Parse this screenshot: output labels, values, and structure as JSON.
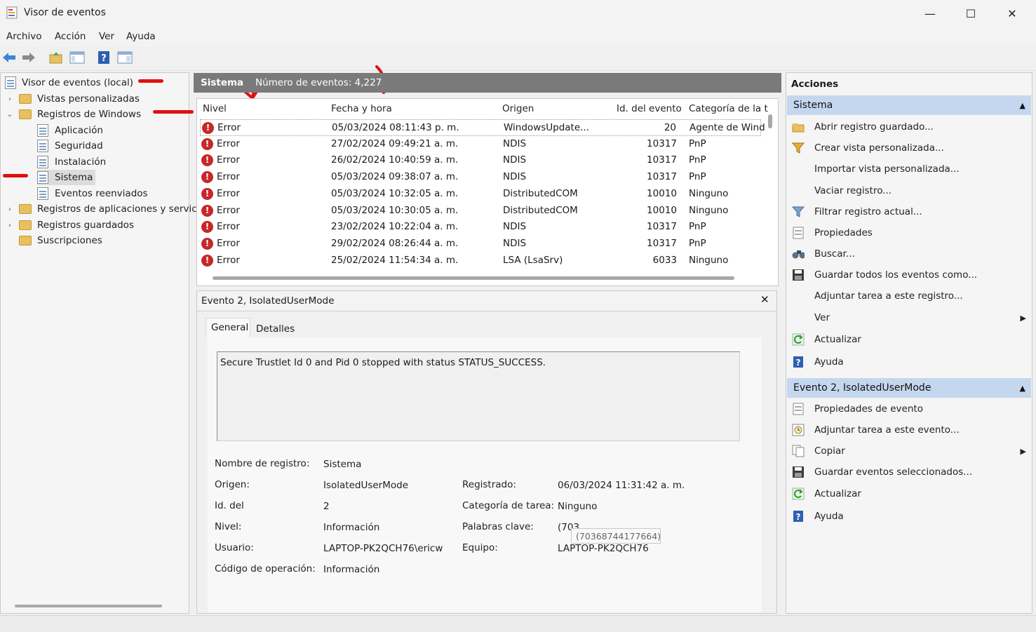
{
  "window": {
    "title": "Visor de eventos",
    "controls": {
      "minimize": "—",
      "maximize": "☐",
      "close": "✕"
    }
  },
  "menu": [
    "Archivo",
    "Acción",
    "Ver",
    "Ayuda"
  ],
  "tree": {
    "root": "Visor de eventos (local)",
    "custom_views": "Vistas personalizadas",
    "windows_logs": "Registros de Windows",
    "logs": [
      "Aplicación",
      "Seguridad",
      "Instalación",
      "Sistema",
      "Eventos reenviados"
    ],
    "app_services": "Registros de aplicaciones y servic",
    "saved": "Registros guardados",
    "subscriptions": "Suscripciones"
  },
  "log_header": {
    "name": "Sistema",
    "count_text": "Número de eventos: 4,227"
  },
  "columns": [
    "Nivel",
    "Fecha y hora",
    "Origen",
    "Id. del evento",
    "Categoría de la t"
  ],
  "events": [
    {
      "level": "Error",
      "date": "05/03/2024 08:11:43 p. m.",
      "source": "WindowsUpdate...",
      "id": "20",
      "category": "Agente de Wind"
    },
    {
      "level": "Error",
      "date": "27/02/2024 09:49:21 a. m.",
      "source": "NDIS",
      "id": "10317",
      "category": "PnP"
    },
    {
      "level": "Error",
      "date": "26/02/2024 10:40:59 a. m.",
      "source": "NDIS",
      "id": "10317",
      "category": "PnP"
    },
    {
      "level": "Error",
      "date": "05/03/2024 09:38:07 a. m.",
      "source": "NDIS",
      "id": "10317",
      "category": "PnP"
    },
    {
      "level": "Error",
      "date": "05/03/2024 10:32:05 a. m.",
      "source": "DistributedCOM",
      "id": "10010",
      "category": "Ninguno"
    },
    {
      "level": "Error",
      "date": "05/03/2024 10:30:05 a. m.",
      "source": "DistributedCOM",
      "id": "10010",
      "category": "Ninguno"
    },
    {
      "level": "Error",
      "date": "23/02/2024 10:22:04 a. m.",
      "source": "NDIS",
      "id": "10317",
      "category": "PnP"
    },
    {
      "level": "Error",
      "date": "29/02/2024 08:26:44 a. m.",
      "source": "NDIS",
      "id": "10317",
      "category": "PnP"
    },
    {
      "level": "Error",
      "date": "25/02/2024 11:54:34 a. m.",
      "source": "LSA (LsaSrv)",
      "id": "6033",
      "category": "Ninguno"
    }
  ],
  "detail": {
    "title": "Evento 2, IsolatedUserMode",
    "tabs": [
      "General",
      "Detalles"
    ],
    "message": "Secure Trustlet Id 0 and Pid 0 stopped with status STATUS_SUCCESS.",
    "labels": {
      "log_name": "Nombre de registro:",
      "source": "Origen:",
      "event_id": "Id. del",
      "level": "Nivel:",
      "user": "Usuario:",
      "opcode": "Código de operación:",
      "logged": "Registrado:",
      "task_category": "Categoría de tarea:",
      "keywords": "Palabras clave:",
      "computer": "Equipo:"
    },
    "values": {
      "log_name": "Sistema",
      "source": "IsolatedUserMode",
      "event_id": "2",
      "level": "Información",
      "user": "LAPTOP-PK2QCH76\\ericw",
      "opcode": "Información",
      "logged": "06/03/2024 11:31:42 a. m.",
      "task_category": "Ninguno",
      "keywords": "(70368744177664)",
      "computer": "LAPTOP-PK2QCH76"
    },
    "tooltip": "(70368744177664)"
  },
  "actions": {
    "title": "Acciones",
    "section1": "Sistema",
    "items1": [
      "Abrir registro guardado...",
      "Crear vista personalizada...",
      "Importar vista personalizada...",
      "Vaciar registro...",
      "Filtrar registro actual...",
      "Propiedades",
      "Buscar...",
      "Guardar todos los eventos como...",
      "Adjuntar tarea a este registro...",
      "Ver",
      "Actualizar",
      "Ayuda"
    ],
    "section2": "Evento 2, IsolatedUserMode",
    "items2": [
      "Propiedades de evento",
      "Adjuntar tarea a este evento...",
      "Copiar",
      "Guardar eventos seleccionados...",
      "Actualizar",
      "Ayuda"
    ]
  }
}
